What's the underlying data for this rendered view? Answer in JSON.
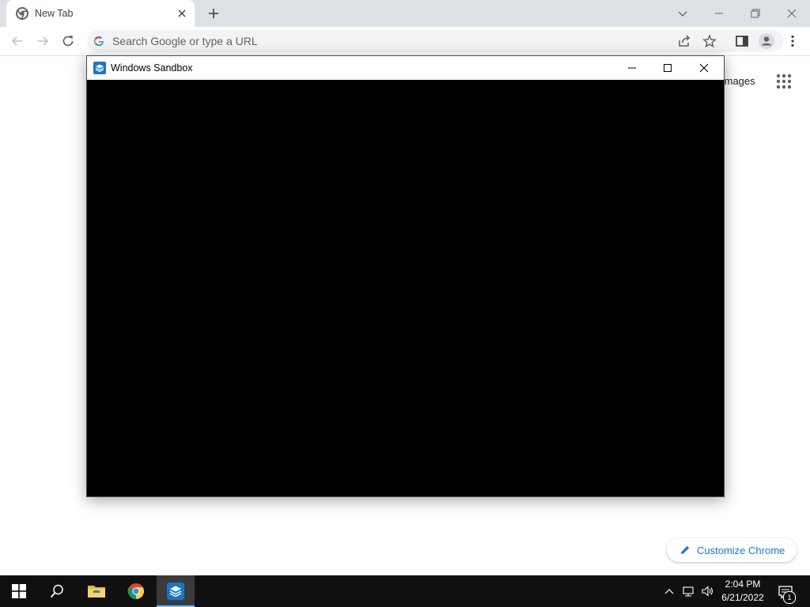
{
  "chrome": {
    "tab": {
      "title": "New Tab"
    },
    "omnibox": {
      "placeholder": "Search Google or type a URL"
    },
    "ntp": {
      "images_link": "Images",
      "customize_label": "Customize Chrome"
    }
  },
  "sandbox_window": {
    "title": "Windows Sandbox"
  },
  "taskbar": {
    "time": "2:04 PM",
    "date": "6/21/2022",
    "notification_count": "1",
    "pinned": [
      "start-icon",
      "search-icon",
      "file-explorer-icon",
      "chrome-icon",
      "windows-sandbox-icon"
    ]
  },
  "colors": {
    "tabstrip": "#dee1e6",
    "accent_blue": "#1a73e8",
    "taskbar": "#101010",
    "sandbox_content": "#000000"
  }
}
